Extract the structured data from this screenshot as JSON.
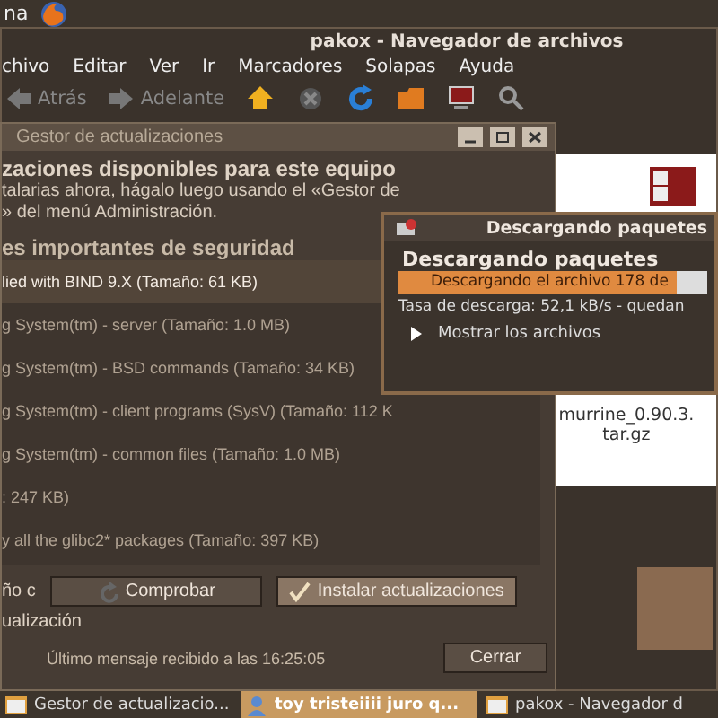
{
  "top_panel": {
    "label": "na"
  },
  "file_browser": {
    "title": "pakox - Navegador de archivos",
    "menu": [
      "chivo",
      "Editar",
      "Ver",
      "Ir",
      "Marcadores",
      "Solapas",
      "Ayuda"
    ],
    "toolbar": [
      {
        "kind": "back",
        "label": "Atrás"
      },
      {
        "kind": "forward",
        "label": "Adelante"
      },
      {
        "kind": "home"
      },
      {
        "kind": "stop"
      },
      {
        "kind": "reload"
      },
      {
        "kind": "folder"
      },
      {
        "kind": "computer"
      },
      {
        "kind": "search"
      }
    ],
    "files": [
      {
        "kind": "file",
        "name": "murrine_0.90.3.\ntar.gz"
      }
    ]
  },
  "update_manager": {
    "title": "Gestor de actualizaciones",
    "heading": "zaciones disponibles para este equipo",
    "description": "talarias ahora, hágalo luego usando el «Gestor de\n» del menú Administración.",
    "section": "es importantes de seguridad",
    "updates": [
      {
        "text": "lied with BIND 9.X (Tamaño: 61 KB)",
        "selected": true
      },
      {
        "text": "g System(tm) - server (Tamaño: 1.0 MB)",
        "selected": false
      },
      {
        "text": "g System(tm) - BSD commands (Tamaño: 34 KB)",
        "selected": false
      },
      {
        "text": "g System(tm) - client programs (SysV) (Tamaño: 112 K",
        "selected": false
      },
      {
        "text": "g System(tm) - common files (Tamaño: 1.0 MB)",
        "selected": false
      },
      {
        "text": ": 247 KB)",
        "selected": false
      },
      {
        "text": "y all the glibc2* packages (Tamaño: 397 KB)",
        "selected": false
      }
    ],
    "left_label": "ño c",
    "check_button": "Comprobar",
    "install_button": "Instalar actualizaciones",
    "details_label": "ualización",
    "status": "Último mensaje recibido a las 16:25:05",
    "close_button": "Cerrar"
  },
  "download_dialog": {
    "title": "Descargando paquetes",
    "heading": "Descargando paquetes",
    "progress": {
      "label": "Descargando el archivo 178 de",
      "level": 0.9
    },
    "rate": "Tasa de descarga: 52,1 kB/s - quedan",
    "expander": {
      "label": "Mostrar los archivos",
      "expanded": false
    }
  },
  "taskbar": [
    {
      "label": "Gestor de actualizacio...",
      "selected": false
    },
    {
      "label": "toy tristeiiii juro q...",
      "selected": true
    },
    {
      "label": "pakox - Navegador d",
      "selected": false
    }
  ]
}
